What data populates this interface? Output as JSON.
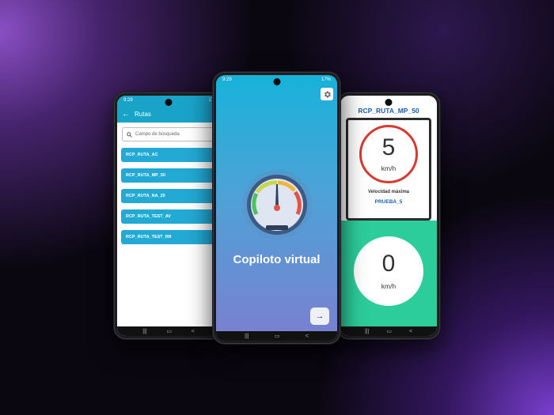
{
  "left_screen": {
    "status_time": "9:29",
    "status_right": "17",
    "title": "Rutas",
    "search_placeholder": "Campo de búsqueda",
    "routes": [
      {
        "label": "RCP_RUTA_AC"
      },
      {
        "label": "RCP_RUTA_MP_50"
      },
      {
        "label": "RCP_RUTA_NA_25"
      },
      {
        "label": "RCP_RUTA_TEST_AV"
      },
      {
        "label": "RCP_RUTA_TEST_RR"
      }
    ]
  },
  "center_screen": {
    "status_time": "9:29",
    "status_right": "17%",
    "app_title": "Copiloto virtual",
    "next_icon": "arrow-right-icon",
    "settings_icon": "gear-icon"
  },
  "right_screen": {
    "route_title": "RCP_RUTA_MP_50",
    "speed_limit": "5",
    "speed_limit_unit": "km/h",
    "limit_caption": "Velocidad máxima",
    "limit_name": "PRUEBA_5",
    "current_speed": "0",
    "current_speed_unit": "km/h"
  },
  "colors": {
    "accent_blue": "#1aa3c9",
    "speed_green": "#2dcc9b",
    "limit_red": "#d63a31"
  }
}
